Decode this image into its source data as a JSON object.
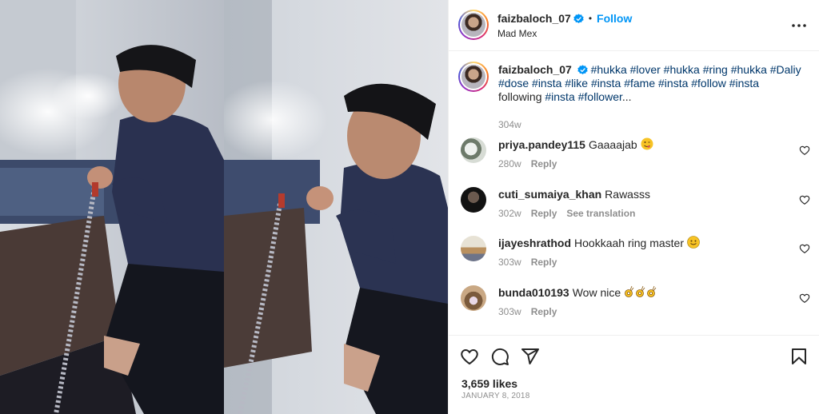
{
  "post": {
    "username": "faizbaloch_07",
    "follow_label": "Follow",
    "location": "Mad Mex",
    "caption": {
      "tags": "#hukka #lover #hukka #ring #hukka #Daliy #dose #insta #like #insta #fame #insta #follow #insta",
      "text_after": "following",
      "tags_end": "#insta #follower",
      "ellipsis": "...",
      "time": "304w"
    },
    "comments": [
      {
        "username": "priya.pandey115",
        "text": "Gaaaajab",
        "time": "280w",
        "reply": "Reply"
      },
      {
        "username": "cuti_sumaiya_khan",
        "text": "Rawasss",
        "time": "302w",
        "reply": "Reply",
        "translate": "See translation"
      },
      {
        "username": "ijayeshrathod",
        "text": "Hookkaah ring master",
        "time": "303w",
        "reply": "Reply"
      },
      {
        "username": "bunda010193",
        "text": "Wow nice",
        "time": "303w",
        "reply": "Reply"
      }
    ],
    "likes": "3,659 likes",
    "date": "JANUARY 8, 2018"
  },
  "colors": {
    "link": "#0095f6",
    "hashtag": "#00376b",
    "muted": "#8e8e8e",
    "verified": "#0095f6"
  },
  "icons": [
    "more-icon",
    "verified-icon",
    "heart-icon",
    "comment-icon",
    "share-icon",
    "bookmark-icon"
  ]
}
